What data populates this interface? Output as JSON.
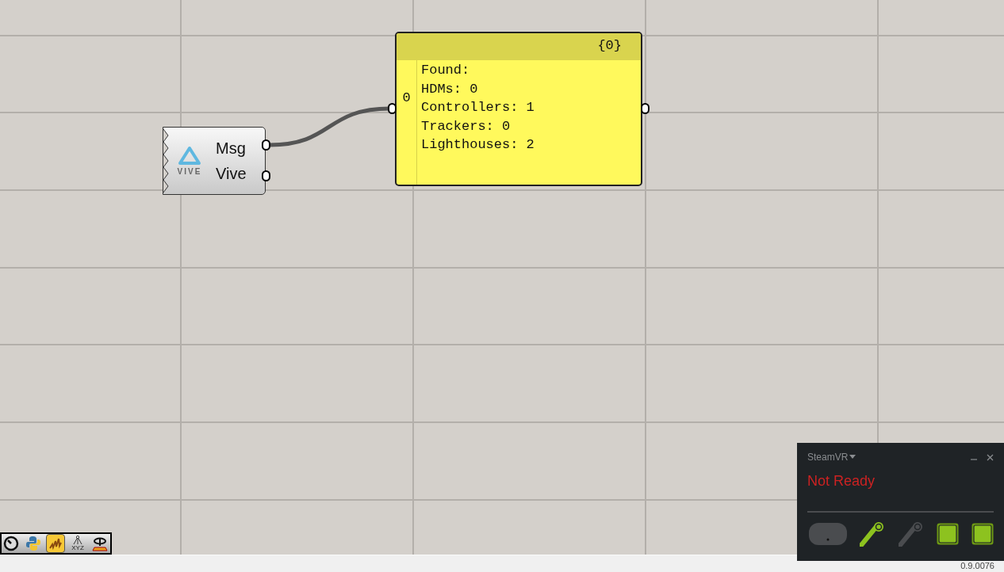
{
  "vive_component": {
    "logo_text": "VIVE",
    "outputs": [
      "Msg",
      "Vive"
    ]
  },
  "panel": {
    "path": "{0}",
    "index": "0",
    "lines": [
      "Found:",
      "HDMs: 0",
      "Controllers: 1",
      "Trackers: 0",
      "Lighthouses: 2"
    ]
  },
  "toolbar": [
    {
      "kind": "timer",
      "selected": false
    },
    {
      "kind": "python",
      "selected": false
    },
    {
      "kind": "wave",
      "selected": true
    },
    {
      "kind": "xyz",
      "label": "XYZ",
      "selected": false
    },
    {
      "kind": "rotate",
      "selected": false
    }
  ],
  "steamvr": {
    "title": "SteamVR",
    "status": "Not Ready",
    "devices": [
      {
        "kind": "headset",
        "on": false
      },
      {
        "kind": "controller",
        "on": true
      },
      {
        "kind": "controller",
        "on": false
      },
      {
        "kind": "base-station",
        "on": true
      },
      {
        "kind": "base-station",
        "on": true
      }
    ]
  },
  "status_bar": {
    "version": "0.9.0076"
  }
}
